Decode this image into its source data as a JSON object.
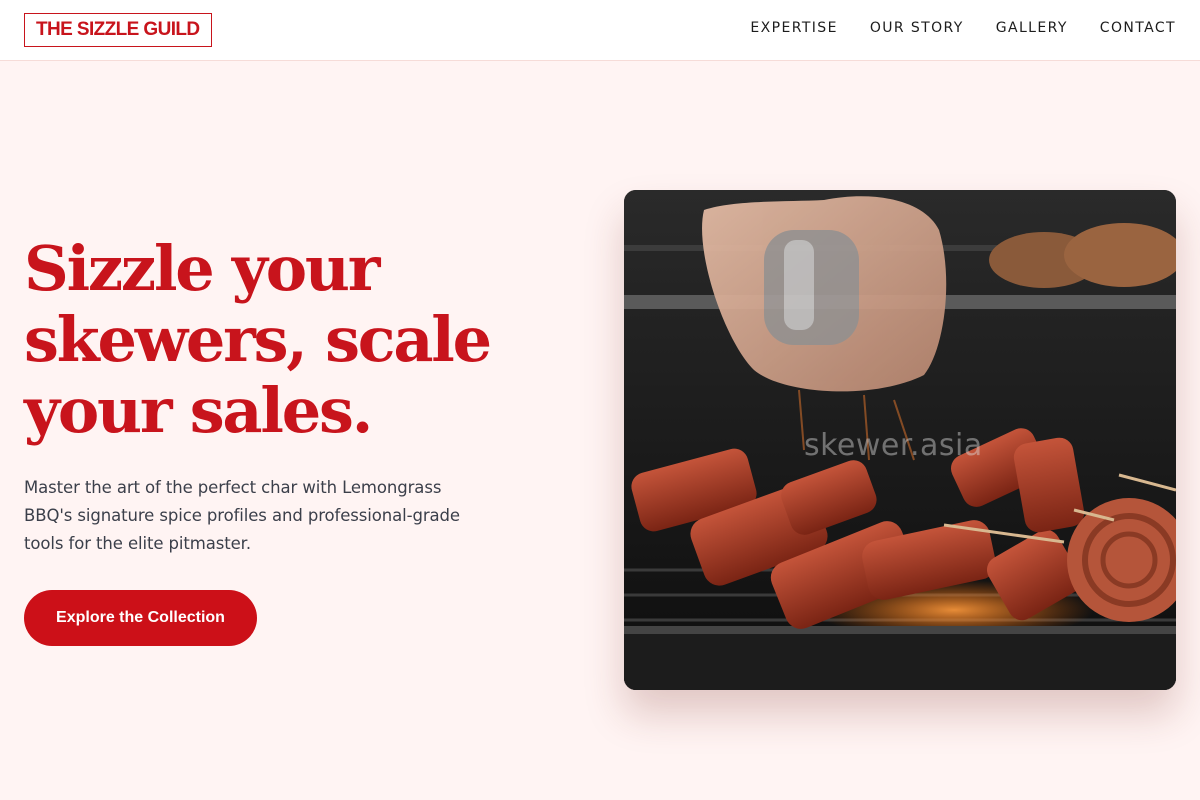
{
  "brand": {
    "logo_text": "THE SIZZLE GUILD",
    "accent": "#c8141c"
  },
  "nav": {
    "items": [
      {
        "label": "EXPERTISE"
      },
      {
        "label": "OUR STORY"
      },
      {
        "label": "GALLERY"
      },
      {
        "label": "CONTACT"
      }
    ]
  },
  "hero": {
    "title": "Sizzle your skewers, scale your sales.",
    "subtitle": "Master the art of the perfect char with Lemongrass BBQ's signature spice profiles and professional-grade tools for the elite pitmaster.",
    "cta_label": "Explore the Collection",
    "image_watermark": "skewer.asia"
  }
}
